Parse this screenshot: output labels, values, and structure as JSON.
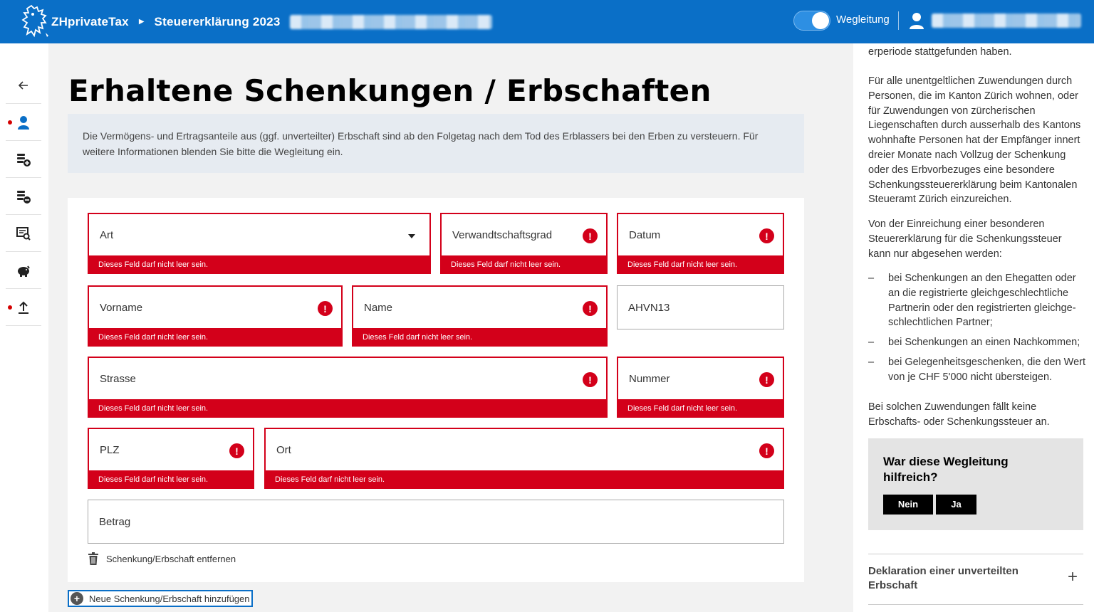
{
  "header": {
    "brand": "ZHprivateTax",
    "breadcrumb": "Steuererklärung 2023",
    "toggle_label": "Wegleitung",
    "toggle_on": true,
    "colors": {
      "primary": "#0a6fc7",
      "error": "#d3001a"
    }
  },
  "sidebar": {
    "items": [
      {
        "icon": "arrow-left-icon",
        "has_dot": false
      },
      {
        "icon": "person-icon",
        "has_dot": true
      },
      {
        "icon": "coins-plus-icon",
        "has_dot": false
      },
      {
        "icon": "coins-minus-icon",
        "has_dot": false
      },
      {
        "icon": "document-search-icon",
        "has_dot": false
      },
      {
        "icon": "piggy-bank-icon",
        "has_dot": false
      },
      {
        "icon": "upload-icon",
        "has_dot": true
      }
    ]
  },
  "main": {
    "title": "Erhaltene Schenkungen / Erbschaften",
    "info_text": "Die Vermögens- und Ertragsanteile aus (ggf. unverteilter) Erbschaft sind ab den Folgetag nach dem Tod des Erblassers bei den Erben zu versteuern. Für weitere Informationen blenden Sie bitte die Wegleitung ein.",
    "error_message": "Dieses Feld darf nicht leer sein.",
    "fields": {
      "art": "Art",
      "verwandtschaftsgrad": "Verwandtschaftsgrad",
      "datum": "Datum",
      "vorname": "Vorname",
      "name": "Name",
      "ahvn13": "AHVN13",
      "strasse": "Strasse",
      "nummer": "Nummer",
      "plz": "PLZ",
      "ort": "Ort",
      "betrag": "Betrag"
    },
    "remove_label": "Schenkung/Erbschaft entfernen",
    "add_label": "Neue Schenkung/Erbschaft hinzufügen"
  },
  "guide": {
    "p0": "erperiode stattgefunden haben.",
    "p1": "Für alle unentgeltlichen Zuwendungen durch Personen, die im Kanton Zürich wohnen, oder für Zuwendungen von zürcherischen Liegenschaften durch ausserhalb des Kantons wohnhafte Personen hat der Empfänger innert dreier Monate nach Vollzug der Schenkung oder des Erbvorbezuges eine besondere Schenkungssteuererklärung beim Kantonalen Steueramt Zürich einzureichen.",
    "p2": "Von der Einreichung einer besonderen Steuererklärung für die Schenkungssteuer kann nur abgesehen werden:",
    "list": [
      "bei Schenkungen an den Ehegatten oder an die registrierte gleichgeschlechtliche Partnerin oder den registrierten gleichge-schlechtlichen Partner;",
      "bei Schenkungen an einen Nachkommen;",
      "bei Gelegenheitsgeschenken, die den Wert von je CHF 5'000 nicht übersteigen."
    ],
    "p3": "Bei solchen Zuwendungen fällt keine Erbschafts- oder Schenkungssteuer an.",
    "feedback_title": "War diese Wegleitung hilfreich?",
    "feedback_no": "Nein",
    "feedback_yes": "Ja",
    "accordion_title": "Deklaration einer unverteilten Erbschaft"
  }
}
